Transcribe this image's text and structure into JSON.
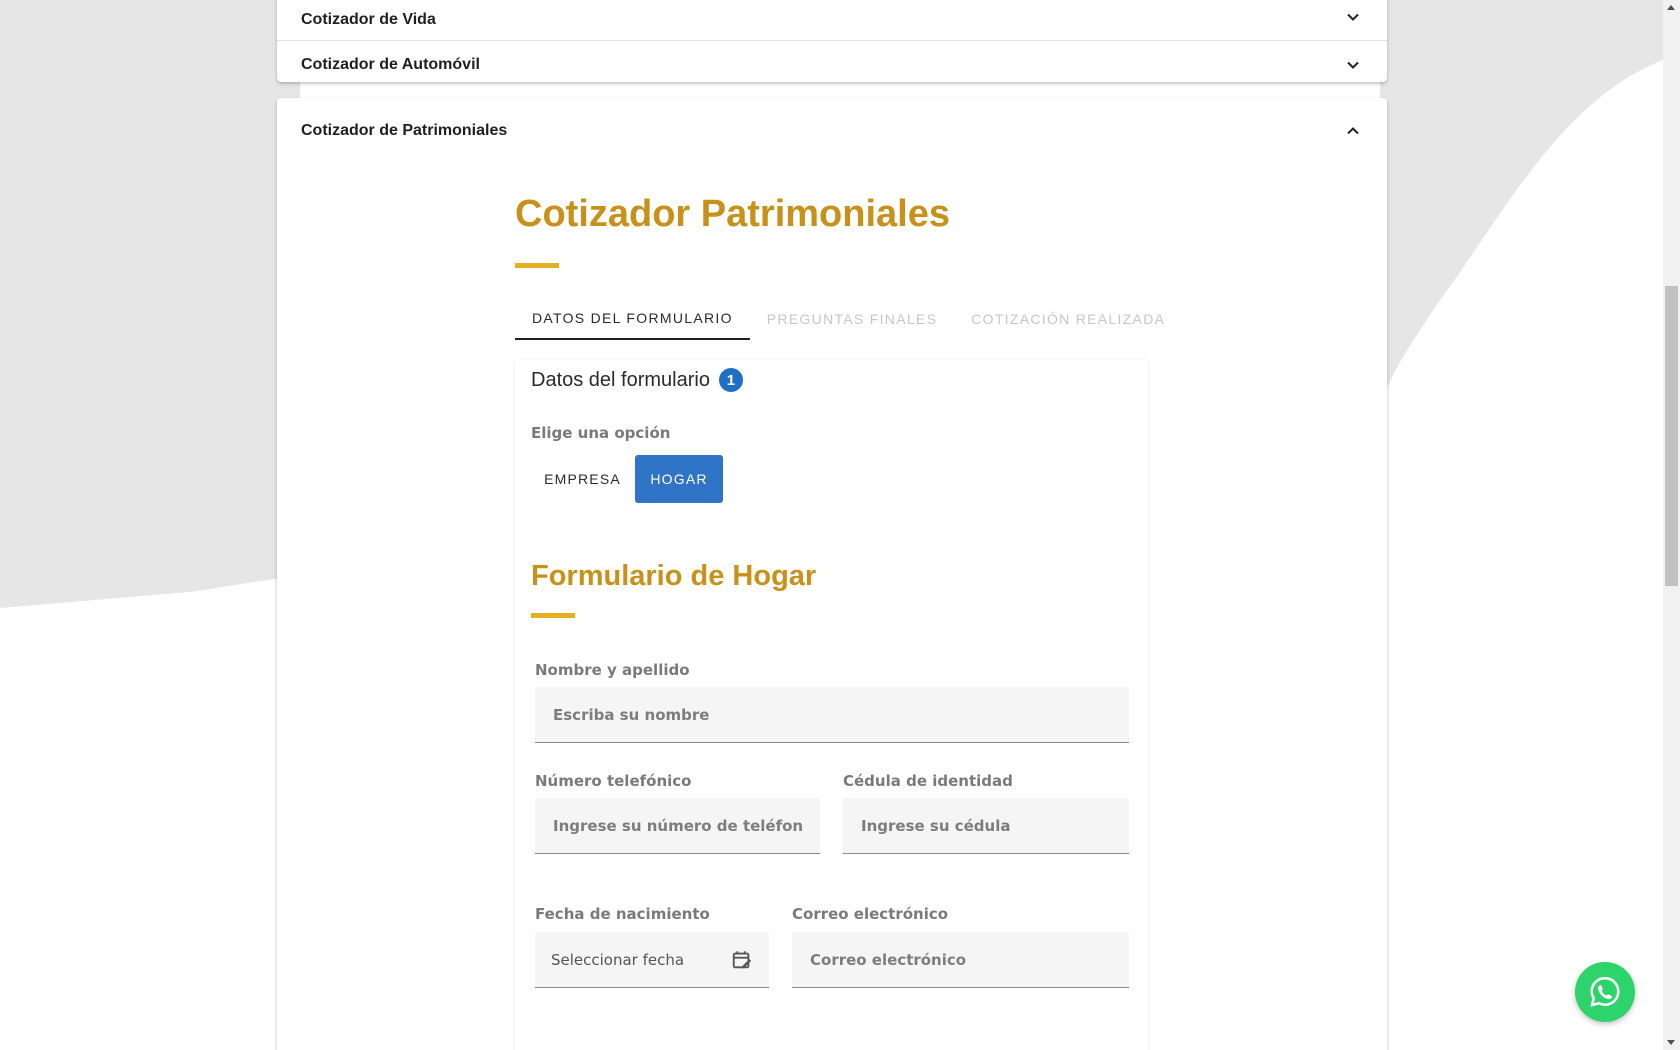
{
  "accordion": {
    "items": [
      {
        "label": "Cotizador de Vida",
        "state": "collapsed",
        "icon": "chevron-down-icon"
      },
      {
        "label": "Cotizador de Automóvil",
        "state": "collapsed",
        "icon": "chevron-down-icon"
      },
      {
        "label": "Cotizador de Patrimoniales",
        "state": "expanded",
        "icon": "chevron-up-icon"
      }
    ]
  },
  "quoter": {
    "title": "Cotizador Patrimoniales",
    "tabs": [
      {
        "label": "DATOS DEL FORMULARIO",
        "active": true
      },
      {
        "label": "PREGUNTAS FINALES",
        "active": false
      },
      {
        "label": "COTIZACIÓN REALIZADA",
        "active": false
      }
    ],
    "step": {
      "title": "Datos del formulario",
      "number": "1"
    },
    "option_label": "Elige una opción",
    "options": [
      {
        "label": "EMPRESA",
        "selected": false
      },
      {
        "label": "HOGAR",
        "selected": true
      }
    ]
  },
  "form": {
    "title": "Formulario de Hogar",
    "fields": {
      "name": {
        "label": "Nombre y apellido",
        "placeholder": "Escriba su nombre",
        "value": ""
      },
      "phone": {
        "label": "Número telefónico",
        "placeholder": "Ingrese su número de teléfono",
        "value": ""
      },
      "id_card": {
        "label": "Cédula de identidad",
        "placeholder": "Ingrese su cédula",
        "value": ""
      },
      "birth_date": {
        "label": "Fecha de nacimiento",
        "placeholder": "Seleccionar fecha",
        "icon": "calendar-icon"
      },
      "email": {
        "label": "Correo electrónico",
        "placeholder": "Correo electrónico",
        "value": ""
      }
    }
  },
  "floating": {
    "icon": "whatsapp-icon"
  },
  "colors": {
    "accent_gold": "#c8911a",
    "underline_gold": "#e5b020",
    "primary_blue": "#2f74c6",
    "badge_blue": "#1f6fc4",
    "whatsapp_green": "#2dd36b",
    "background_gray": "#e6e6e6"
  }
}
